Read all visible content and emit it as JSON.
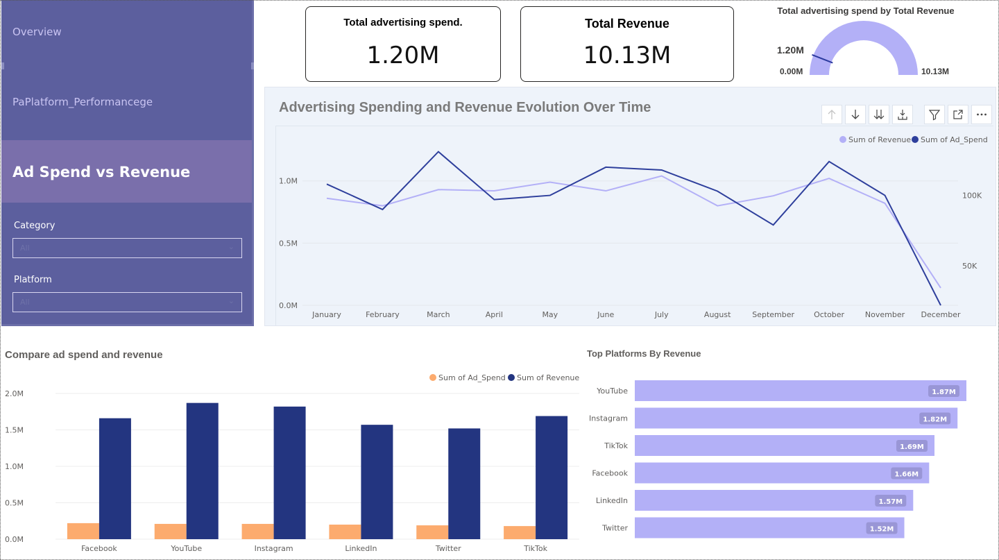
{
  "sidebar": {
    "nav": [
      {
        "label": "Overview"
      },
      {
        "label": "PaPlatform_Performancege"
      },
      {
        "label": "Ad Spend vs Revenue"
      }
    ],
    "slicers": [
      {
        "label": "Category",
        "value": "All"
      },
      {
        "label": "Platform",
        "value": "All"
      }
    ]
  },
  "kpis": {
    "spend": {
      "title": "Total advertising spend.",
      "value": "1.20M"
    },
    "revenue": {
      "title": "Total Revenue",
      "value": "10.13M"
    }
  },
  "gauge": {
    "title": "Total advertising spend by Total Revenue",
    "min_label": "0.00M",
    "max_label": "10.13M",
    "value_label": "1.20M",
    "value": 1.2,
    "max": 10.13,
    "color": "#b3b0f7",
    "needle_color": "#2b3a9e"
  },
  "colors": {
    "revenue_light": "#b3b0f7",
    "spend_dark": "#2e3f9c",
    "bar_spend": "#fcab6e",
    "bar_revenue": "#233580",
    "hbar": "#b3b0f7"
  },
  "toolbar_icons": [
    "arrow-up-icon",
    "arrow-down-icon",
    "double-arrow-down-icon",
    "expand-hierarchy-icon",
    "filter-icon",
    "focus-mode-icon",
    "more-options-icon"
  ],
  "chart_data": [
    {
      "type": "line",
      "title": "Advertising Spending and Revenue Evolution Over Time",
      "categories": [
        "January",
        "February",
        "March",
        "April",
        "May",
        "June",
        "July",
        "August",
        "September",
        "October",
        "November",
        "December"
      ],
      "series": [
        {
          "name": "Sum of Revenue",
          "axis": "left",
          "values": [
            860000,
            800000,
            930000,
            920000,
            990000,
            920000,
            1040000,
            800000,
            880000,
            1020000,
            820000,
            140000
          ]
        },
        {
          "name": "Sum of Ad_Spend",
          "axis": "right",
          "values": [
            108000,
            90000,
            131000,
            97000,
            100000,
            120000,
            118000,
            103000,
            79000,
            124000,
            100000,
            22000
          ]
        }
      ],
      "y_left": {
        "ticks": [
          0,
          500000,
          1000000
        ],
        "tick_labels": [
          "0.0M",
          "0.5M",
          "1.0M"
        ],
        "range": [
          0,
          1450000
        ]
      },
      "y_right": {
        "ticks": [
          50000,
          100000
        ],
        "tick_labels": [
          "50K",
          "100K"
        ],
        "range": [
          22000,
          150000
        ]
      },
      "legend": "top-right",
      "grid": true
    },
    {
      "type": "bar",
      "title": "Compare ad spend and revenue",
      "categories": [
        "Facebook",
        "YouTube",
        "Instagram",
        "LinkedIn",
        "Twitter",
        "TikTok"
      ],
      "series": [
        {
          "name": "Sum of Ad_Spend",
          "values": [
            220000,
            210000,
            210000,
            200000,
            190000,
            180000
          ]
        },
        {
          "name": "Sum of Revenue",
          "values": [
            1660000,
            1870000,
            1820000,
            1570000,
            1520000,
            1690000
          ]
        }
      ],
      "y_ticks": [
        0,
        500000,
        1000000,
        1500000,
        2000000
      ],
      "y_tick_labels": [
        "0.0M",
        "0.5M",
        "1.0M",
        "1.5M",
        "2.0M"
      ],
      "ylim": [
        0,
        2000000
      ],
      "legend": "top-right",
      "grid": true
    },
    {
      "type": "bar",
      "orientation": "horizontal",
      "title": "Top Platforms By Revenue",
      "categories": [
        "YouTube",
        "Instagram",
        "TikTok",
        "Facebook",
        "LinkedIn",
        "Twitter"
      ],
      "values": [
        1870000,
        1820000,
        1690000,
        1660000,
        1570000,
        1520000
      ],
      "data_labels": [
        "1.87M",
        "1.82M",
        "1.69M",
        "1.66M",
        "1.57M",
        "1.52M"
      ]
    }
  ]
}
